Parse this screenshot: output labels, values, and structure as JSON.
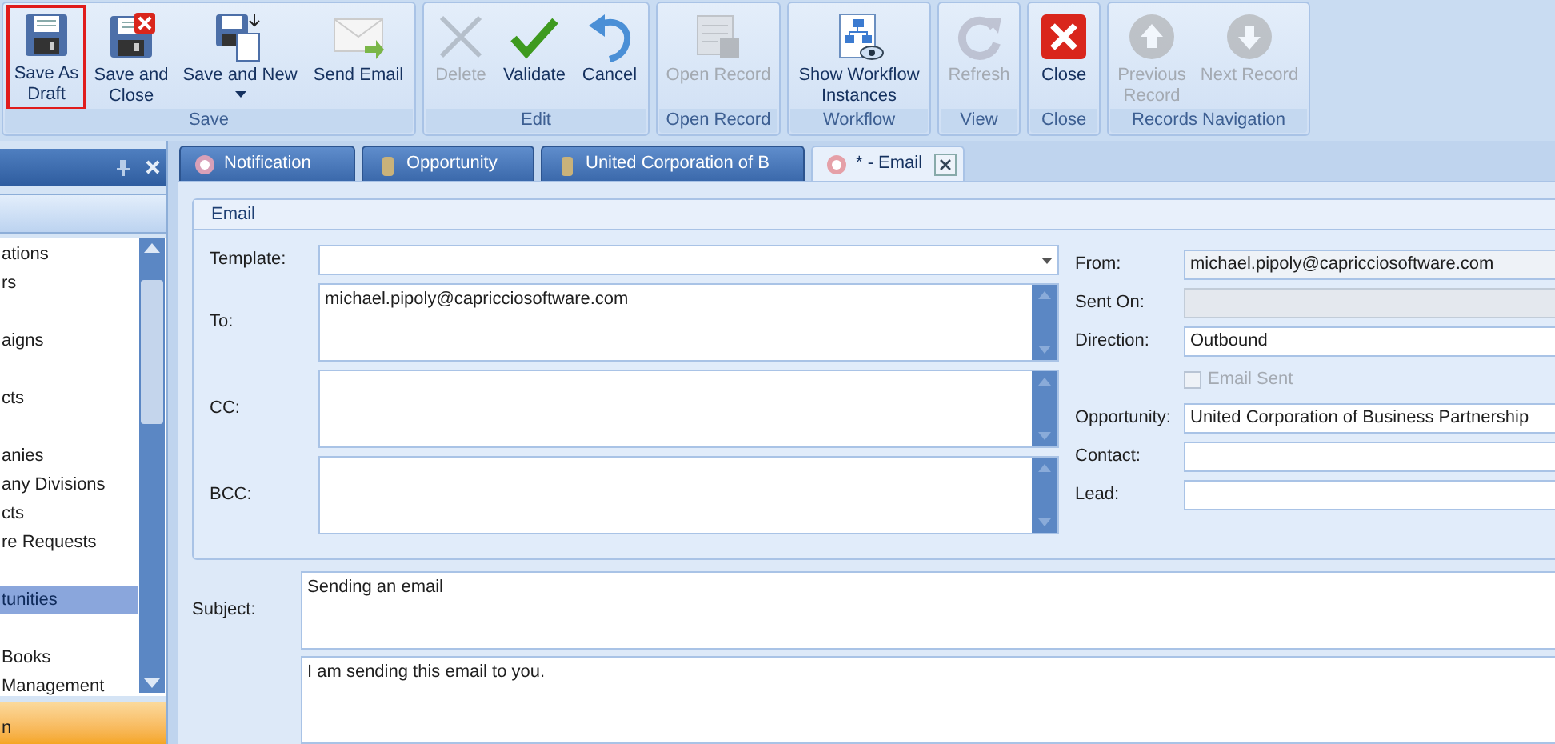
{
  "ribbon": {
    "groups": [
      {
        "label": "Save",
        "buttons": [
          {
            "label": "Save As Draft",
            "disabled": false,
            "highlighted": true,
            "dropdown": false
          },
          {
            "label": "Save and Close",
            "disabled": false,
            "highlighted": false,
            "dropdown": false
          },
          {
            "label": "Save and New",
            "disabled": false,
            "highlighted": false,
            "dropdown": true
          },
          {
            "label": "Send Email",
            "disabled": false,
            "highlighted": false,
            "dropdown": false
          }
        ]
      },
      {
        "label": "Edit",
        "buttons": [
          {
            "label": "Delete",
            "disabled": true,
            "highlighted": false,
            "dropdown": false
          },
          {
            "label": "Validate",
            "disabled": false,
            "highlighted": false,
            "dropdown": false
          },
          {
            "label": "Cancel",
            "disabled": false,
            "highlighted": false,
            "dropdown": false
          }
        ]
      },
      {
        "label": "Open Record",
        "buttons": [
          {
            "label": "Open Record",
            "disabled": true,
            "highlighted": false,
            "dropdown": false
          }
        ]
      },
      {
        "label": "Workflow",
        "buttons": [
          {
            "label": "Show Workflow Instances",
            "disabled": false,
            "highlighted": false,
            "dropdown": false
          }
        ]
      },
      {
        "label": "View",
        "buttons": [
          {
            "label": "Refresh",
            "disabled": true,
            "highlighted": false,
            "dropdown": false
          }
        ]
      },
      {
        "label": "Close",
        "buttons": [
          {
            "label": "Close",
            "disabled": false,
            "highlighted": false,
            "dropdown": false
          }
        ]
      },
      {
        "label": "Records Navigation",
        "buttons": [
          {
            "label": "Previous Record",
            "disabled": true,
            "highlighted": false,
            "dropdown": false
          },
          {
            "label": "Next Record",
            "disabled": true,
            "highlighted": false,
            "dropdown": false
          }
        ]
      }
    ]
  },
  "sidebar": {
    "items": [
      {
        "label": "ations",
        "selected": false
      },
      {
        "label": "rs",
        "selected": false
      },
      {
        "label": "aigns",
        "selected": false
      },
      {
        "label": "cts",
        "selected": false
      },
      {
        "label": "anies",
        "selected": false
      },
      {
        "label": "any Divisions",
        "selected": false
      },
      {
        "label": "cts",
        "selected": false
      },
      {
        "label": "re Requests",
        "selected": false
      },
      {
        "label": "tunities",
        "selected": true
      },
      {
        "label": "Books",
        "selected": false
      },
      {
        "label": "Management",
        "selected": false
      }
    ],
    "bottom_item": "n"
  },
  "tabs": [
    {
      "label": "Notification",
      "selected": false
    },
    {
      "label": "Opportunity",
      "selected": false
    },
    {
      "label": "United Corporation of B",
      "selected": false
    },
    {
      "label": "* - Email",
      "selected": true
    }
  ],
  "email_group": {
    "title": "Email",
    "left_fields": [
      {
        "label": "Template:",
        "kind": "dropdown"
      },
      {
        "label": "To:",
        "value": "michael.pipoly@capricciosoftware.com",
        "kind": "memo"
      },
      {
        "label": "CC:",
        "kind": "memo"
      },
      {
        "label": "BCC:",
        "kind": "memo"
      }
    ],
    "right_fields": [
      {
        "label": "From:",
        "value": "michael.pipoly@capricciosoftware.com",
        "kind": "text",
        "disabled": false,
        "readonly": true
      },
      {
        "label": "Sent On:",
        "kind": "text",
        "disabled": true,
        "readonly": true
      },
      {
        "label": "Direction:",
        "value": "Outbound",
        "kind": "text",
        "disabled": false,
        "readonly": false
      },
      {
        "label": "Email Sent",
        "kind": "checkbox",
        "checked": false,
        "disabled": true
      },
      {
        "label": "Opportunity:",
        "value": "United Corporation of Business Partnership",
        "kind": "text",
        "disabled": false,
        "readonly": false
      },
      {
        "label": "Contact:",
        "kind": "text",
        "disabled": false,
        "readonly": false
      },
      {
        "label": "Lead:",
        "kind": "text",
        "disabled": false,
        "readonly": false
      }
    ]
  },
  "subject": {
    "label": "Subject:",
    "value": "Sending an email"
  },
  "body": {
    "value": "I am sending this email to you."
  }
}
